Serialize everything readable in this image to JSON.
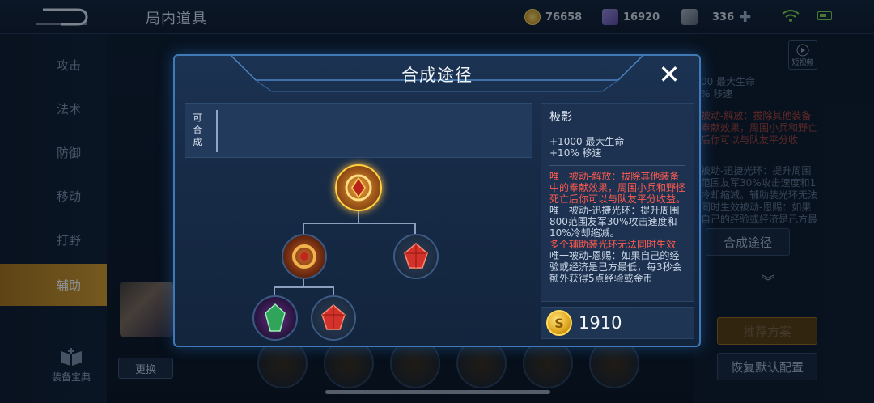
{
  "header": {
    "title": "局内道具",
    "gold": "76658",
    "gems": "16920",
    "tickets": "336"
  },
  "sidebar": {
    "items": [
      {
        "label": "攻击"
      },
      {
        "label": "法术"
      },
      {
        "label": "防御"
      },
      {
        "label": "移动"
      },
      {
        "label": "打野"
      },
      {
        "label": "辅助"
      }
    ],
    "active": "辅助",
    "wiki_label": "装备宝典",
    "swap_label": "更换"
  },
  "background_panel": {
    "video_label": "短视频",
    "stat_lines": [
      "00 最大生命",
      "% 移速"
    ],
    "red_text": "被动-解放：拔除其他装备奉献效果，周围小兵和野亡后你可以与队友平分收",
    "gray_text": "被动-迅捷光环：提升周围范围友军30%攻击速度和1冷却缩减。辅助装光环无法同时生效被动-恩赐：如果自己的经验或经济是己方最低，每3秒会额外获得5点经验或金币",
    "recipe_label": "合成途径",
    "recommend_label": "推荐方案",
    "reset_label": "恢复默认配置"
  },
  "dialog": {
    "title": "合成途径",
    "can_compose_label": "可合成",
    "detail": {
      "name": "极影",
      "stats": [
        "+1000 最大生命",
        "+10% 移速"
      ],
      "passive_red": "唯一被动-解放：拔除其他装备中的奉献效果，周围小兵和野怪死亡后你可以与队友平分收益。",
      "passive_aura": "唯一被动-迅捷光环：提升周围800范围友军30%攻击速度和10%冷却缩减。",
      "aura_note": "多个辅助装光环无法同时生效",
      "passive_grace": "唯一被动-恩赐：如果自己的经验或经济是己方最低，每3秒会额外获得5点经验或金币"
    },
    "price": "1910"
  },
  "colors": {
    "accent": "#3f79b6",
    "active_tab": "#d29b2c",
    "red_text": "#ff5a4e",
    "gold": "#ffd95a"
  }
}
